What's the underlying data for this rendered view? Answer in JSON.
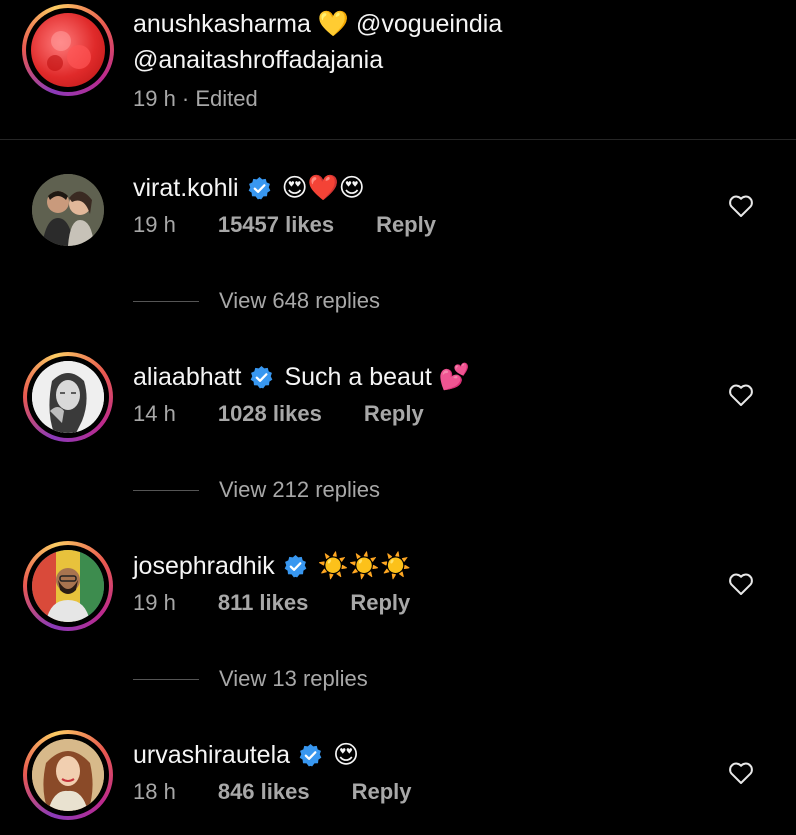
{
  "caption": {
    "username": "anushkasharma",
    "emoji": "💛",
    "mentions_line1": "@vogueindia",
    "mentions_line2": "@anaitashroffadajania",
    "time": "19 h · Edited"
  },
  "comments": [
    {
      "username": "virat.kohli",
      "verified": true,
      "text": "😍❤️😍",
      "time": "19 h",
      "likes": "15457 likes",
      "reply": "Reply",
      "view_replies": "View 648 replies",
      "avatar_icon": "profile-photo"
    },
    {
      "username": "aliaabhatt",
      "verified": true,
      "text": "Such a beaut 💕",
      "time": "14 h",
      "likes": "1028 likes",
      "reply": "Reply",
      "view_replies": "View 212 replies",
      "avatar_icon": "profile-photo"
    },
    {
      "username": "josephradhik",
      "verified": true,
      "text": "☀️☀️☀️",
      "time": "19 h",
      "likes": "811 likes",
      "reply": "Reply",
      "view_replies": "View 13 replies",
      "avatar_icon": "profile-photo"
    },
    {
      "username": "urvashirautela",
      "verified": true,
      "text": "😍",
      "time": "18 h",
      "likes": "846 likes",
      "reply": "Reply",
      "avatar_icon": "profile-photo"
    }
  ],
  "colors": {
    "background": "#000000",
    "muted": "#a8a8a8",
    "verified": "#3897f0"
  }
}
